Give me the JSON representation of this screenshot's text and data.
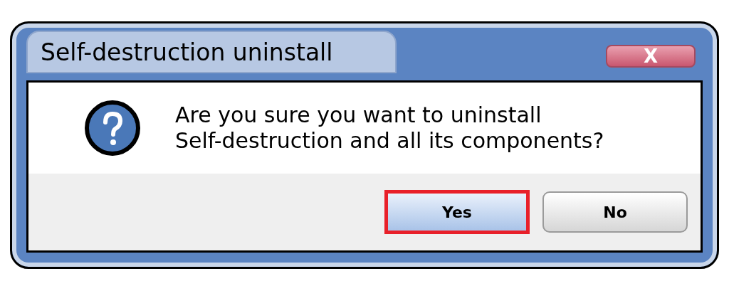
{
  "window": {
    "title": "Self-destruction uninstall",
    "close_label": "X"
  },
  "message": "Are you sure you want to uninstall\nSelf-destruction and all its components?",
  "buttons": [
    {
      "label": "Yes",
      "selected": true
    },
    {
      "label": "No",
      "selected": false
    }
  ]
}
